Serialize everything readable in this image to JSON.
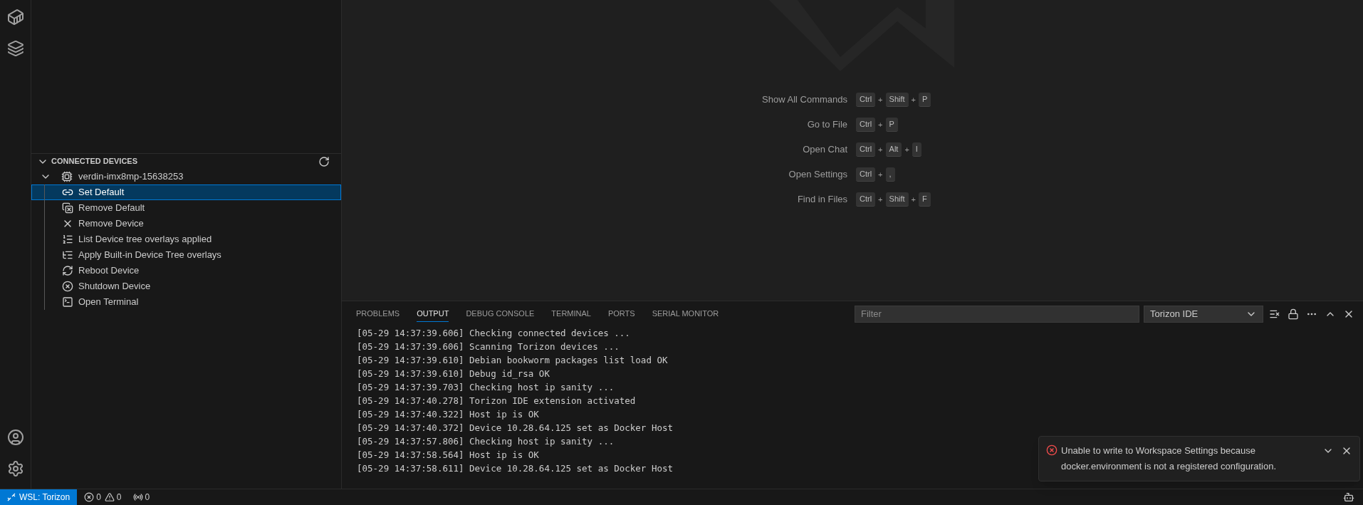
{
  "sidebar": {
    "section": {
      "title": "CONNECTED DEVICES",
      "expanded": true
    },
    "device": {
      "name": "verdin-imx8mp-15638253",
      "expanded": true,
      "actions": [
        {
          "label": "Set Default",
          "selected": true
        },
        {
          "label": "Remove Default",
          "selected": false
        },
        {
          "label": "Remove Device",
          "selected": false
        },
        {
          "label": "List Device tree overlays applied",
          "selected": false
        },
        {
          "label": "Apply Built-in Device Tree overlays",
          "selected": false
        },
        {
          "label": "Reboot Device",
          "selected": false
        },
        {
          "label": "Shutdown Device",
          "selected": false
        },
        {
          "label": "Open Terminal",
          "selected": false
        }
      ]
    }
  },
  "welcome": {
    "shortcuts": [
      {
        "label": "Show All Commands",
        "separator": "+",
        "keys": [
          "Ctrl",
          "Shift",
          "P"
        ]
      },
      {
        "label": "Go to File",
        "separator": "+",
        "keys": [
          "Ctrl",
          "P"
        ]
      },
      {
        "label": "Open Chat",
        "separator": "+",
        "keys": [
          "Ctrl",
          "Alt",
          "I"
        ]
      },
      {
        "label": "Open Settings",
        "separator": "+",
        "keys": [
          "Ctrl",
          ","
        ]
      },
      {
        "label": "Find in Files",
        "separator": "+",
        "keys": [
          "Ctrl",
          "Shift",
          "F"
        ]
      }
    ]
  },
  "panel": {
    "tabs": [
      {
        "label": "PROBLEMS",
        "selected": false
      },
      {
        "label": "OUTPUT",
        "selected": true
      },
      {
        "label": "DEBUG CONSOLE",
        "selected": false
      },
      {
        "label": "TERMINAL",
        "selected": false
      },
      {
        "label": "PORTS",
        "selected": false
      },
      {
        "label": "SERIAL MONITOR",
        "selected": false
      }
    ],
    "filter": {
      "placeholder": "Filter"
    },
    "channel": "Torizon IDE",
    "output": [
      "[05-29 14:37:39.606] Checking connected devices ...",
      "[05-29 14:37:39.606] Scanning Torizon devices ...",
      "[05-29 14:37:39.610] Debian bookworm packages list load OK",
      "[05-29 14:37:39.610] Debug id_rsa OK",
      "[05-29 14:37:39.703] Checking host ip sanity ...",
      "[05-29 14:37:40.278] Torizon IDE extension activated",
      "[05-29 14:37:40.322] Host ip is OK",
      "[05-29 14:37:40.372] Device 10.28.64.125 set as Docker Host",
      "[05-29 14:37:57.806] Checking host ip sanity ...",
      "[05-29 14:37:58.564] Host ip is OK",
      "[05-29 14:37:58.611] Device 10.28.64.125 set as Docker Host"
    ]
  },
  "notification": {
    "message": "Unable to write to Workspace Settings because docker.environment is not a registered configuration."
  },
  "status_bar": {
    "remote": "WSL: Torizon",
    "errors": "0",
    "warnings": "0",
    "ports": "0"
  }
}
